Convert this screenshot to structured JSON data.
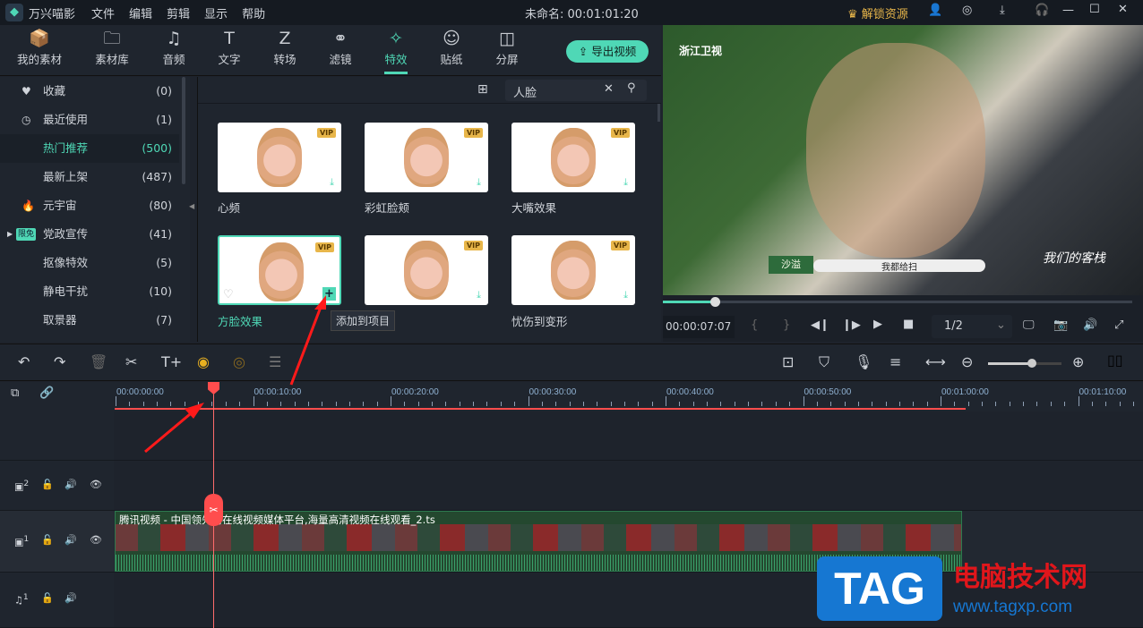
{
  "app": {
    "name": "万兴喵影",
    "menu": [
      "文件",
      "编辑",
      "剪辑",
      "显示",
      "帮助"
    ],
    "project_title": "未命名: 00:01:01:20",
    "unlock": "解锁资源"
  },
  "tabs": [
    {
      "label": "我的素材",
      "icon": "📦"
    },
    {
      "label": "素材库",
      "icon": "🗀"
    },
    {
      "label": "音频",
      "icon": "♫"
    },
    {
      "label": "文字",
      "icon": "T"
    },
    {
      "label": "转场",
      "icon": "Z"
    },
    {
      "label": "滤镜",
      "icon": "⚭"
    },
    {
      "label": "特效",
      "icon": "✧"
    },
    {
      "label": "贴纸",
      "icon": "☺"
    },
    {
      "label": "分屏",
      "icon": "◫"
    }
  ],
  "export_label": "导出视频",
  "sidebar": [
    {
      "label": "收藏",
      "count": "(0)",
      "icon": "♥"
    },
    {
      "label": "最近使用",
      "count": "(1)",
      "icon": "◷"
    },
    {
      "label": "热门推荐",
      "count": "(500)"
    },
    {
      "label": "最新上架",
      "count": "(487)"
    },
    {
      "label": "元宇宙",
      "count": "(80)",
      "icon": "🔥"
    },
    {
      "label": "党政宣传",
      "count": "(41)",
      "badge": "限免"
    },
    {
      "label": "抠像特效",
      "count": "(5)"
    },
    {
      "label": "静电干扰",
      "count": "(10)"
    },
    {
      "label": "取景器",
      "count": "(7)"
    }
  ],
  "search": {
    "value": "人脸"
  },
  "effects": [
    {
      "label": "心频",
      "badge": "VIP"
    },
    {
      "label": "彩虹脸颊",
      "badge": "VIP"
    },
    {
      "label": "大嘴效果",
      "badge": "VIP"
    },
    {
      "label": "方脸效果",
      "badge": "VIP"
    },
    {
      "label": "",
      "badge": "VIP"
    },
    {
      "label": "忧伤到变形",
      "badge": "VIP"
    }
  ],
  "tooltip": "添加到项目",
  "preview": {
    "channel": "浙江卫视",
    "caption_name": "沙溢",
    "caption_text": "我都给扫",
    "show_logo": "我们的客栈",
    "timecode": "00:00:07:07",
    "quality": "1/2",
    "progress": 0.11
  },
  "ruler": [
    "00:00:00:00",
    "00:00:10:00",
    "00:00:20:00",
    "00:00:30:00",
    "00:00:40:00",
    "00:00:50:00",
    "00:01:00:00",
    "00:01:10:00"
  ],
  "tracks": {
    "v2": "2",
    "v1": "1",
    "a1": "1"
  },
  "clip_name": "腾讯视频 - 中国领先的在线视频媒体平台,海量高清视频在线观看_2.ts",
  "zoom_level": 0.6,
  "watermark": {
    "logo": "TAG",
    "title": "电脑技术网",
    "url": "www.tagxp.com"
  },
  "colors": {
    "accent": "#4fd8b6",
    "playhead": "#ff4d4d"
  }
}
